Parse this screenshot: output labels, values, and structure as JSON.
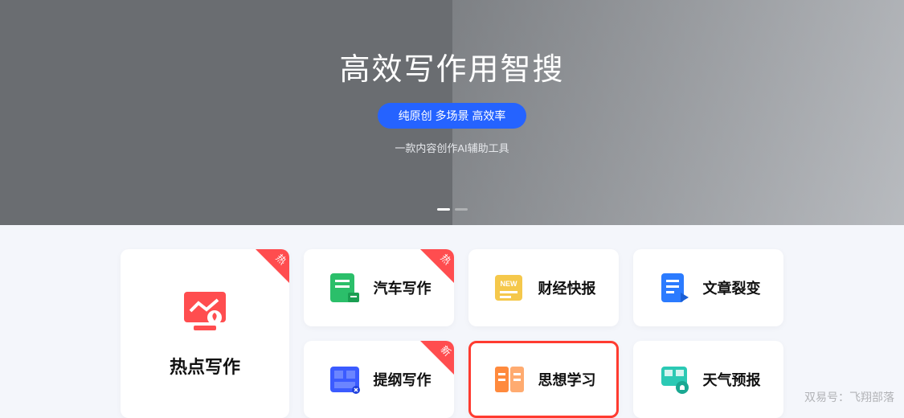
{
  "hero": {
    "title": "高效写作用智搜",
    "pill": "纯原创 多场景 高效率",
    "subtitle": "一款内容创作AI辅助工具"
  },
  "cards": {
    "hot_writing": {
      "label": "热点写作",
      "ribbon": "热",
      "icon": "chart-monitor-icon",
      "color": "#ff4d4f"
    },
    "car_writing": {
      "label": "汽车写作",
      "ribbon": "热",
      "icon": "doc-green-icon",
      "color": "#2bbf6a"
    },
    "finance_news": {
      "label": "财经快报",
      "icon": "news-yellow-icon",
      "color": "#f5c84b"
    },
    "article_split": {
      "label": "文章裂变",
      "icon": "doc-blue-icon",
      "color": "#2b7bff"
    },
    "outline_writing": {
      "label": "提纲写作",
      "ribbon": "新",
      "icon": "grid-blue-icon",
      "color": "#3b5bff"
    },
    "thought_study": {
      "label": "思想学习",
      "icon": "book-orange-icon",
      "color": "#ff8a3d",
      "highlighted": true
    },
    "weather": {
      "label": "天气预报",
      "icon": "card-teal-icon",
      "color": "#2bc9b4"
    }
  },
  "watermark": "双易号：飞翔部落"
}
